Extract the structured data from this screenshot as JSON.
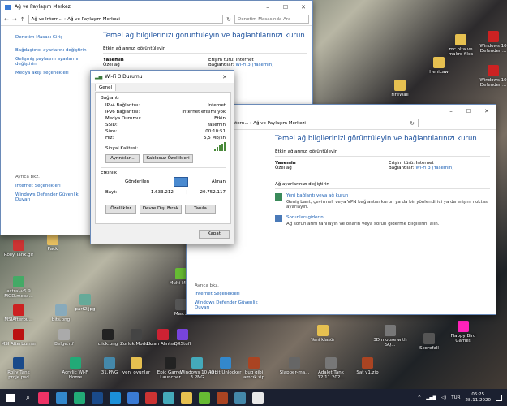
{
  "desktop_icons": [
    {
      "label": "Rolly Tank.gif",
      "color": "#c33"
    },
    {
      "label": "Pack",
      "color": "#e8c060"
    },
    {
      "label": "astral-v6.9 MOD.mcpa...",
      "color": "#4a6"
    },
    {
      "label": "MSIAfterbu...",
      "color": "#c22"
    },
    {
      "label": "MSI Afterburner",
      "color": "#b11"
    },
    {
      "label": "Rolly Tank proje.psd",
      "color": "#1a4a8a"
    },
    {
      "label": "bits.png",
      "color": "#8ab"
    },
    {
      "label": "part2.jpg",
      "color": "#6a9"
    },
    {
      "label": "Belge.rtf",
      "color": "#aaa"
    },
    {
      "label": "click.png",
      "color": "#222"
    },
    {
      "label": "Acrylic Wi-Fi Home",
      "color": "#2a7"
    },
    {
      "label": "31.PNG",
      "color": "#48a"
    },
    {
      "label": "Microsoft Edge",
      "color": "#1b8fd8"
    },
    {
      "label": "Zorluk Modu...",
      "color": "#444"
    },
    {
      "label": "Ekran Alıntısı...",
      "color": "#c23"
    },
    {
      "label": "QRStuff",
      "color": "#74d"
    },
    {
      "label": "yeni oyunlar",
      "color": "#e6c050"
    },
    {
      "label": "Epic Games Launcher",
      "color": "#222"
    },
    {
      "label": "Windows 10 Ağ 3.PNG",
      "color": "#4ab"
    },
    {
      "label": "IObit Unlocker",
      "color": "#38c"
    },
    {
      "label": "bug gibi amcık.zip",
      "color": "#a42"
    },
    {
      "label": "Multi-Me...",
      "color": "#6b3"
    },
    {
      "label": "Mas...",
      "color": "#555"
    },
    {
      "label": "FireWall",
      "color": "#e6c050"
    },
    {
      "label": "mc olta ve makro files",
      "color": "#e6c050"
    },
    {
      "label": "Windows 10 Defender ...",
      "color": "#c22"
    },
    {
      "label": "Henicaw",
      "color": "#e6c050"
    },
    {
      "label": "Windows 10 Defender ...",
      "color": "#c22"
    },
    {
      "label": "Yeni klasör",
      "color": "#e6c050"
    },
    {
      "label": "Adalet Tank 12.11.202...",
      "color": "#777"
    },
    {
      "label": "Slapper-ma...",
      "color": "#666"
    },
    {
      "label": "Sat v1.zip",
      "color": "#a42"
    },
    {
      "label": "3D mouse with SQ...",
      "color": "#777"
    },
    {
      "label": "Scorefall",
      "color": "#555"
    },
    {
      "label": "Flappy Bird Games",
      "color": "#f2b"
    }
  ],
  "win_back": {
    "title": "Ağ ve Paylaşım Merkezi",
    "crumb1": "Ağ ve Intern...",
    "crumb2": "Ağ ve Paylaşım Merkezi",
    "search": "Denetim Masasında Ara",
    "left_links": [
      "Denetim Masası Giriş",
      "Bağdaştırıcı ayarlarını değiştirin",
      "Gelişmiş paylaşım ayarlarını değiştirin",
      "Medya akışı seçenekleri"
    ],
    "see_also": "Ayrıca bkz.",
    "internet_opts": "Internet Seçenekleri",
    "defender": "Windows Defender Güvenlik Duvarı",
    "heading": "Temel ağ bilgilerinizi görüntüleyin ve bağlantılarınızı kurun",
    "active": "Etkin ağlarınızı görüntüleyin",
    "net_name": "Yasemin",
    "net_type": "Özel ağ",
    "access_label": "Erişim türü:",
    "access_val": "Internet",
    "conn_label": "Bağlantılar:",
    "conn_val": "Wi-Fi 3 (Yasemin)"
  },
  "win_front": {
    "title": "",
    "crumb1": "Ağ ve Intern...",
    "crumb2": "Ağ ve Paylaşım Merkezi",
    "search": "",
    "heading": "Temel ağ bilgilerinizi görüntüleyin ve bağlantılarınızı kurun",
    "active": "Etkin ağlarınızı görüntüleyin",
    "net_name": "Yasemin",
    "net_type": "Özel ağ",
    "access_label": "Erişim türü:",
    "access_val": "Internet",
    "conn_label": "Bağlantılar:",
    "conn_val": "Wi-Fi 3 (Yasemin)",
    "change": "Ağ ayarlarınızı değiştirin",
    "new_conn": "Yeni bağlantı veya ağ kurun",
    "new_conn_desc": "Geniş bant, çevirmeli veya VPN bağlantısı kurun ya da bir yönlendirici ya da erişim noktası ayarlayın.",
    "troubleshoot": "Sorunları giderin",
    "troubleshoot_desc": "Ağ sorunlarını tanılayın ve onarın veya sorun giderme bilgilerini alın.",
    "see_also": "Ayrıca bkz.",
    "internet_opts": "Internet Seçenekleri",
    "defender": "Windows Defender Güvenlik Duvarı"
  },
  "wifi": {
    "title": "Wi-Fi 3 Durumu",
    "tab": "Genel",
    "conn": "Bağlantı",
    "rows": [
      [
        "IPv4 Bağlantısı:",
        "Internet"
      ],
      [
        "IPv6 Bağlantısı:",
        "Internet erişimi yok"
      ],
      [
        "Medya Durumu:",
        "Etkin"
      ],
      [
        "SSID:",
        "Yasemin"
      ],
      [
        "Süre:",
        "00:10:51"
      ],
      [
        "Hız:",
        "5,5 Mb/sn"
      ]
    ],
    "signal": "Sinyal Kalitesi:",
    "details": "Ayrıntılar...",
    "wireless": "Kablosuz Özellikleri",
    "activity": "Etkinlik",
    "sent": "Gönderilen",
    "recv": "Alınan",
    "bytes": "Bayt:",
    "sent_val": "1.633.212",
    "recv_val": "20.752.117",
    "props": "Özellikler",
    "disable": "Devre Dışı Bırak",
    "diagnose": "Tanıla",
    "close": "Kapat"
  },
  "taskbar": {
    "lang": "TUR",
    "time": "06:25",
    "date": "28.11.2020"
  }
}
